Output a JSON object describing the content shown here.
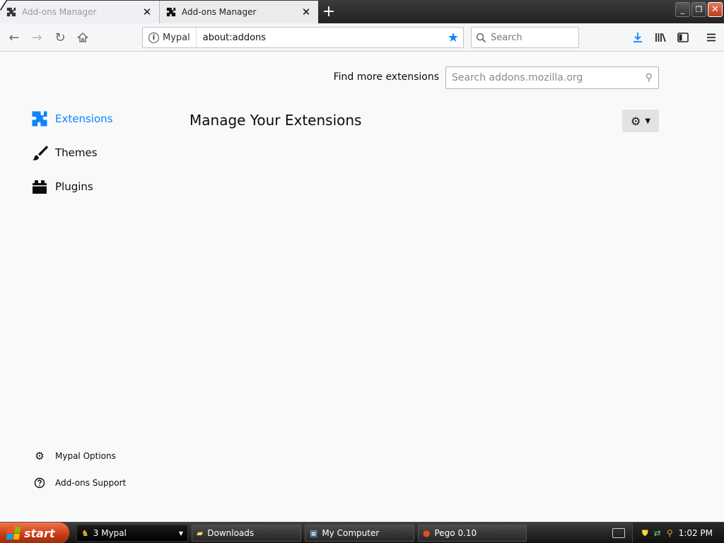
{
  "tabs": [
    {
      "label": "Add-ons Manager",
      "icon": "puzzle-icon"
    },
    {
      "label": "Add-ons Manager",
      "icon": "puzzle-icon"
    }
  ],
  "newtab_label": "+",
  "window_controls": {
    "minimize": "_",
    "restore": "❐",
    "close": "✕"
  },
  "nav": {
    "identity_label": "Mypal",
    "url": "about:addons",
    "search_placeholder": "Search"
  },
  "content": {
    "find_more_label": "Find more extensions",
    "amo_search_placeholder": "Search addons.mozilla.org",
    "heading": "Manage Your Extensions",
    "categories": [
      {
        "label": "Extensions",
        "icon": "puzzle-icon",
        "selected": true
      },
      {
        "label": "Themes",
        "icon": "brush-icon",
        "selected": false
      },
      {
        "label": "Plugins",
        "icon": "plugin-icon",
        "selected": false
      }
    ],
    "footer": [
      {
        "label": "Mypal Options",
        "icon": "gear-icon"
      },
      {
        "label": "Add-ons Support",
        "icon": "help-icon"
      }
    ]
  },
  "taskbar": {
    "start_label": "start",
    "items": [
      {
        "label": "3 Mypal"
      },
      {
        "label": "Downloads"
      },
      {
        "label": "My Computer"
      },
      {
        "label": "Pego 0.10"
      }
    ],
    "clock": "1:02 PM"
  },
  "colors": {
    "accent": "#0a84ff",
    "start": "#c33b13"
  }
}
